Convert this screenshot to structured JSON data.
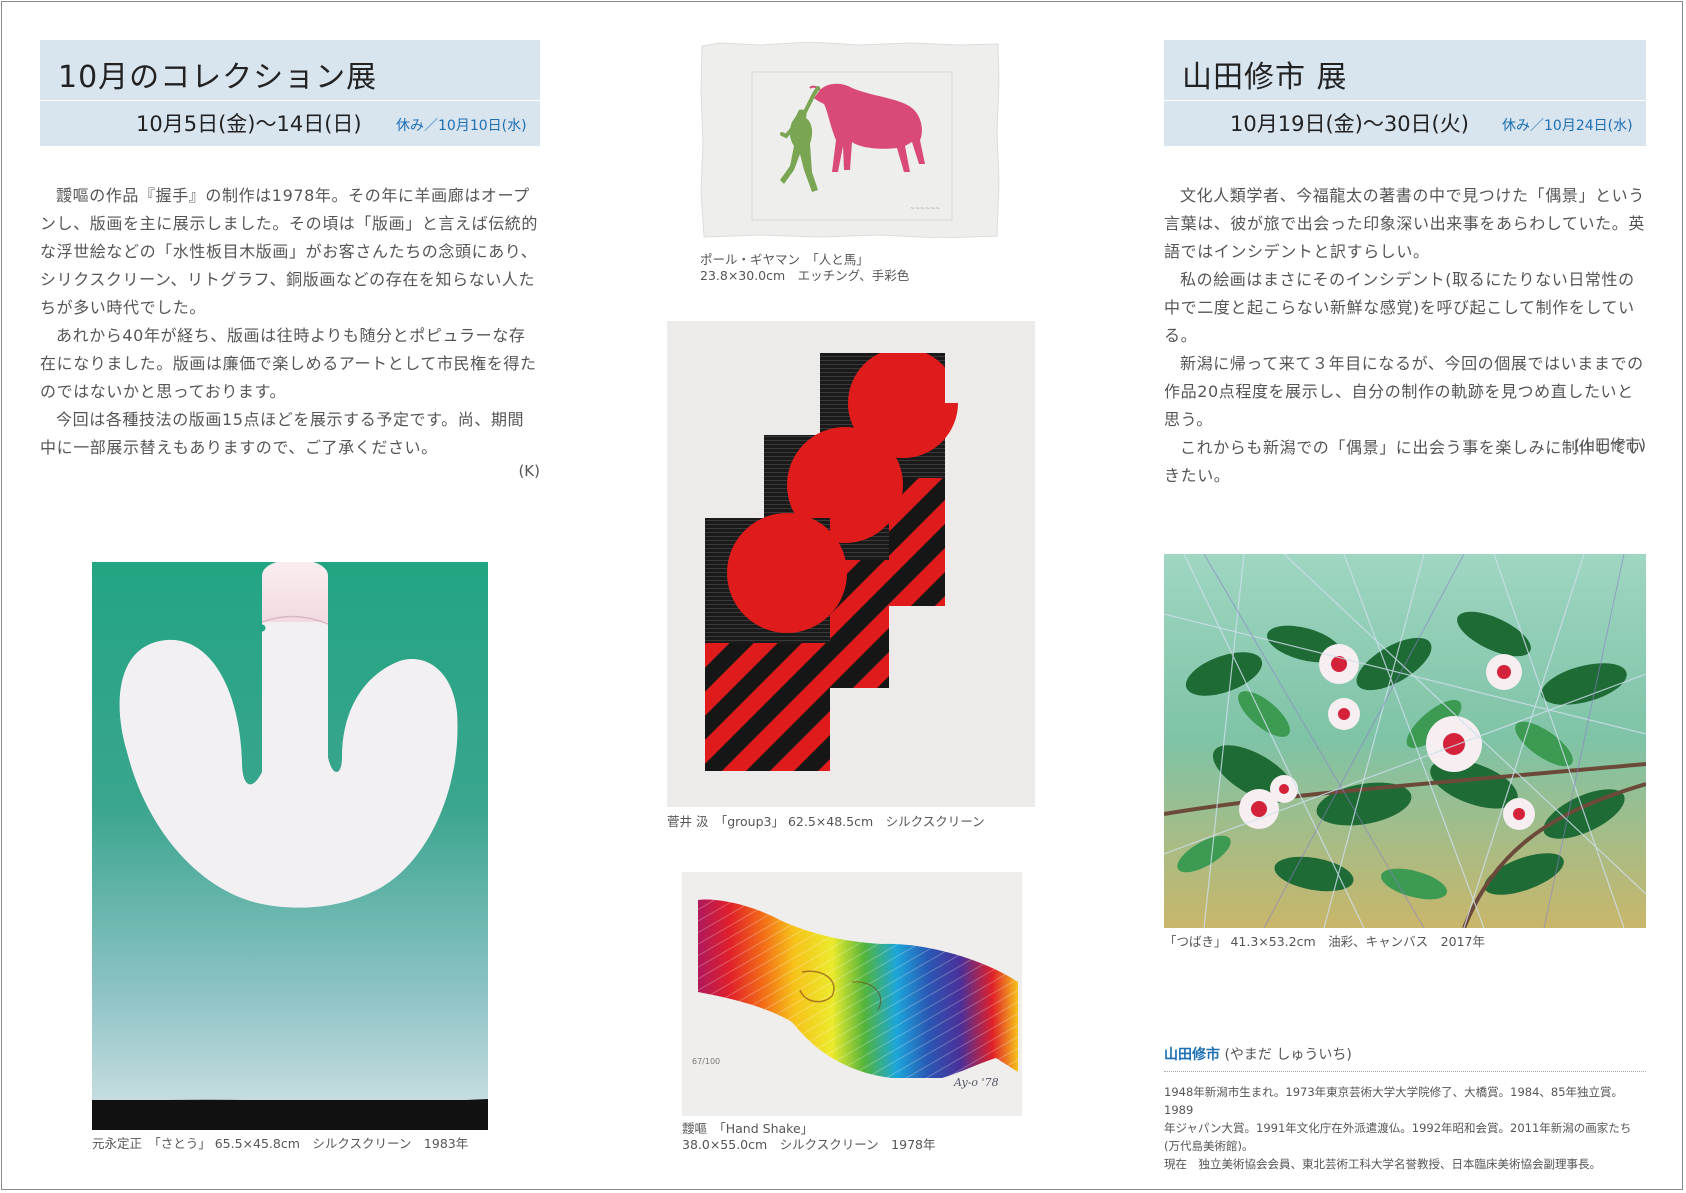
{
  "left": {
    "title": "10月のコレクション展",
    "dates": "10月5日(金)〜14日(日)",
    "closed": "休み／10月10日(水)",
    "paragraphs": [
      "靉嘔の作品『握手』の制作は1978年。その年に羊画廊はオープンし、版画を主に展示しました。その頃は「版画」と言えば伝統的な浮世絵などの「水性板目木版画」がお客さんたちの念頭にあり、シリクスクリーン、リトグラフ、銅版画などの存在を知らない人たちが多い時代でした。",
      "あれから40年が経ち、版画は往時よりも随分とポピュラーな存在になりました。版画は廉価で楽しめるアートとして市民権を得たのではないかと思っております。",
      "今回は各種技法の版画15点ほどを展示する予定です。尚、期間中に一部展示替えもありますので、ご了承ください。"
    ],
    "signature": "(K)",
    "artwork_caption": "元永定正　「さとう」 65.5×45.8cm　シルクスクリーン　1983年"
  },
  "middle": {
    "art1_caption_line1": "ポール・ギヤマン　「人と馬」",
    "art1_caption_line2": "23.8×30.0cm　エッチング、手彩色",
    "art2_caption": "菅井 汲　「group3」 62.5×48.5cm　シルクスクリーン",
    "art3_caption_line1": "靉嘔　「Hand Shake」",
    "art3_caption_line2": "38.0×55.0cm　シルクスクリーン　1978年",
    "art3_edition": "67/100",
    "art3_signature": "Ay-o '78"
  },
  "right": {
    "title": "山田修市 展",
    "dates": "10月19日(金)〜30日(火)",
    "closed": "休み／10月24日(水)",
    "paragraphs": [
      "文化人類学者、今福龍太の著書の中で見つけた「偶景」という言葉は、彼が旅で出会った印象深い出来事をあらわしていた。英語ではインシデントと訳すらしい。",
      "私の絵画はまさにそのインシデント(取るにたりない日常性の中で二度と起こらない新鮮な感覚)を呼び起こして制作をしている。",
      "新潟に帰って来て３年目になるが、今回の個展ではいままでの作品20点程度を展示し、自分の制作の軌跡を見つめ直したいと思う。",
      "これからも新潟での「偶景」に出会う事を楽しみに制作していきたい。"
    ],
    "signature": "(山田修市)",
    "artwork_caption": "「つばき」 41.3×53.2cm　油彩、キャンバス　2017年",
    "bio_name": "山田修市",
    "bio_reading": "(やまだ しゅういち)",
    "bio_lines": [
      "1948年新潟市生まれ。1973年東京芸術大学大学院修了、大橋賞。1984、85年独立賞。1989",
      "年ジャパン大賞。1991年文化庁在外派遣渡仏。1992年昭和会賞。2011年新潟の画家たち",
      "(万代島美術館)。",
      "現在　独立美術協会会員、東北芸術工科大学名誉教授、日本臨床美術協会副理事長。"
    ]
  },
  "colors": {
    "header_bg": "#d8e4ee",
    "accent_blue": "#1d6fb4",
    "red": "#e01b1b",
    "teal": "#2aa787"
  }
}
